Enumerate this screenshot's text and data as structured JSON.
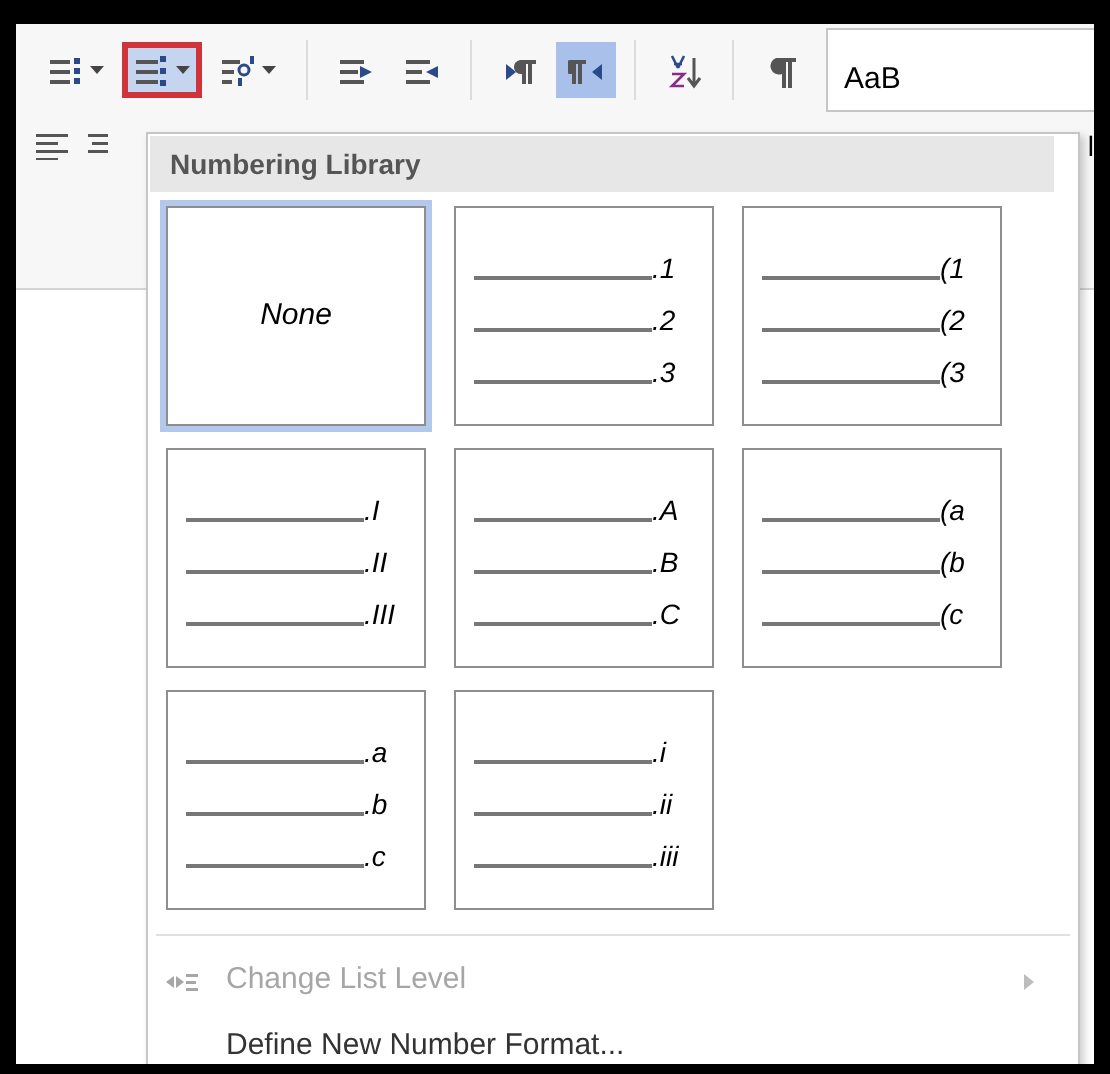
{
  "toolbar": [
    {
      "kind": "button",
      "selected": false,
      "dropdown": true
    },
    {
      "kind": "button",
      "selected": true,
      "dropdown": true
    },
    {
      "kind": "button",
      "selected": false,
      "dropdown": true
    },
    {
      "kind": "separator"
    },
    {
      "kind": "button",
      "selected": false,
      "dropdown": false
    },
    {
      "kind": "button",
      "selected": false,
      "dropdown": false
    },
    {
      "kind": "separator"
    },
    {
      "kind": "button",
      "selected": false,
      "dropdown": false
    },
    {
      "kind": "button",
      "selected": true,
      "dropdown": false
    },
    {
      "kind": "separator"
    },
    {
      "kind": "button",
      "selected": false,
      "dropdown": false
    },
    {
      "kind": "separator"
    },
    {
      "kind": "button",
      "selected": false,
      "dropdown": false
    }
  ],
  "style_gallery": {
    "sample": "AaB"
  },
  "behind_text": "l",
  "numbering_menu": {
    "title": "Numbering Library",
    "formats": [
      {
        "kind": "none",
        "label": "None",
        "selected": true
      },
      {
        "kind": "list",
        "markers": [
          ".1",
          ".2",
          ".3"
        ],
        "selected": false
      },
      {
        "kind": "list",
        "markers": [
          "(1",
          "(2",
          "(3"
        ],
        "selected": false
      },
      {
        "kind": "list",
        "markers": [
          ".I",
          ".II",
          ".III"
        ],
        "selected": false
      },
      {
        "kind": "list",
        "markers": [
          ".A",
          ".B",
          ".C"
        ],
        "selected": false
      },
      {
        "kind": "list",
        "markers": [
          "(a",
          "(b",
          "(c"
        ],
        "selected": false
      },
      {
        "kind": "list",
        "markers": [
          ".a",
          ".b",
          ".c"
        ],
        "selected": false
      },
      {
        "kind": "list",
        "markers": [
          ".i",
          ".ii",
          ".iii"
        ],
        "selected": false
      }
    ],
    "items": [
      {
        "label": "Change List Level",
        "disabled": true,
        "submenu": true
      },
      {
        "label": "Define New Number Format...",
        "disabled": false,
        "submenu": false
      }
    ]
  }
}
